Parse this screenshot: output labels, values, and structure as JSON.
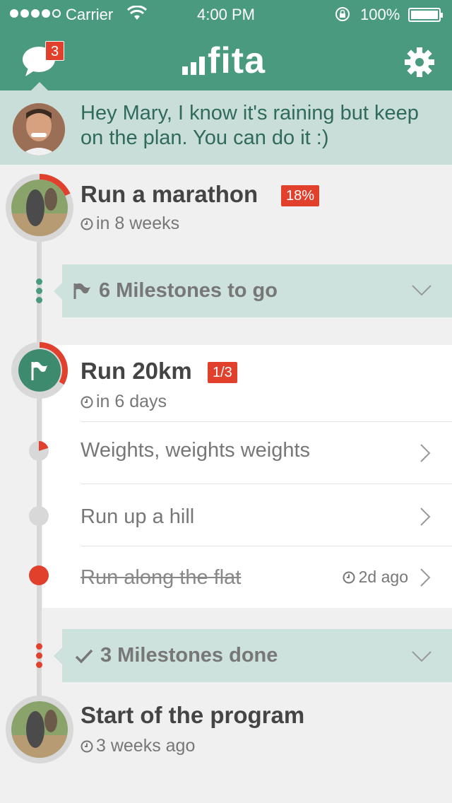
{
  "status_bar": {
    "carrier": "Carrier",
    "time": "4:00 PM",
    "battery": "100%"
  },
  "header": {
    "notification_count": "3",
    "logo": "fita"
  },
  "message": {
    "text": "Hey Mary, I know it's raining but keep on the plan. You can do it :)"
  },
  "goal": {
    "title": "Run a marathon",
    "progress_label": "18%",
    "progress_fraction": 0.18,
    "due": "in 8 weeks"
  },
  "milestones_to_go": {
    "label": "6 Milestones to go"
  },
  "current_milestone": {
    "title": "Run 20km",
    "progress_label": "1/3",
    "due": "in 6 days",
    "tasks": [
      {
        "label": "Weights, weights weights",
        "meta": "",
        "done": false
      },
      {
        "label": "Run up a hill",
        "meta": "",
        "done": false
      },
      {
        "label": "Run along the flat",
        "meta": "2d ago",
        "done": true
      }
    ]
  },
  "milestones_done": {
    "label": "3 Milestones done"
  },
  "start": {
    "title": "Start of the program",
    "when": "3 weeks ago"
  },
  "colors": {
    "header": "#4a9a80",
    "accent_red": "#e0402c",
    "message_bg": "#c9ded9",
    "milestone_bg": "#cde1dd"
  }
}
